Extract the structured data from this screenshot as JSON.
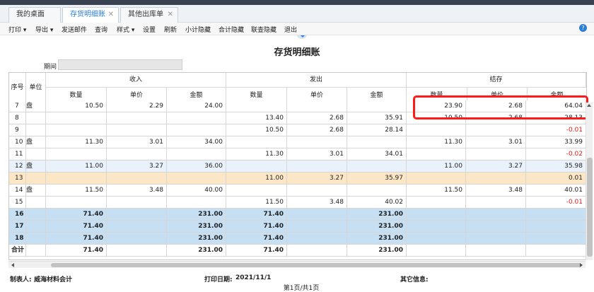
{
  "tabs": [
    {
      "label": "我的桌面",
      "active": false,
      "closable": false
    },
    {
      "label": "存货明细账",
      "active": true,
      "closable": true
    },
    {
      "label": "其他出库单",
      "active": false,
      "closable": true
    }
  ],
  "toolbar": {
    "items": [
      {
        "label": "打印",
        "dropdown": true
      },
      {
        "label": "导出",
        "dropdown": true
      },
      {
        "label": "发送邮件",
        "dropdown": false
      },
      {
        "label": "查询",
        "dropdown": false
      },
      {
        "label": "样式",
        "dropdown": true
      },
      {
        "label": "设置",
        "dropdown": false
      },
      {
        "label": "刷新",
        "dropdown": false
      },
      {
        "label": "小计隐藏",
        "dropdown": false
      },
      {
        "label": "合计隐藏",
        "dropdown": false
      },
      {
        "label": "联查隐藏",
        "dropdown": false
      },
      {
        "label": "退出",
        "dropdown": false
      }
    ],
    "help_icon": "?"
  },
  "report": {
    "title": "存货明细账",
    "period_label": "期间",
    "period_value": ""
  },
  "table": {
    "headers": {
      "seq": "序号",
      "unit": "单位",
      "in_group": "收入",
      "out_group": "发出",
      "bal_group": "结存",
      "qty": "数量",
      "price": "单价",
      "amount": "金额"
    },
    "rows": [
      {
        "seq": "7",
        "unit": "盘",
        "in_qty": "10.50",
        "in_price": "2.29",
        "in_amt": "24.00",
        "out_qty": "",
        "out_price": "",
        "out_amt": "",
        "bal_qty": "23.90",
        "bal_price": "2.68",
        "bal_amt": "64.04",
        "style": "normal"
      },
      {
        "seq": "8",
        "unit": "",
        "in_qty": "",
        "in_price": "",
        "in_amt": "",
        "out_qty": "13.40",
        "out_price": "2.68",
        "out_amt": "35.91",
        "bal_qty": "10.50",
        "bal_price": "2.68",
        "bal_amt": "28.13",
        "style": "normal"
      },
      {
        "seq": "9",
        "unit": "",
        "in_qty": "",
        "in_price": "",
        "in_amt": "",
        "out_qty": "10.50",
        "out_price": "2.68",
        "out_amt": "28.14",
        "bal_qty": "",
        "bal_price": "",
        "bal_amt": "-0.01",
        "style": "normal"
      },
      {
        "seq": "10",
        "unit": "盘",
        "in_qty": "11.30",
        "in_price": "3.01",
        "in_amt": "34.00",
        "out_qty": "",
        "out_price": "",
        "out_amt": "",
        "bal_qty": "11.30",
        "bal_price": "3.01",
        "bal_amt": "33.99",
        "style": "normal"
      },
      {
        "seq": "11",
        "unit": "",
        "in_qty": "",
        "in_price": "",
        "in_amt": "",
        "out_qty": "11.30",
        "out_price": "3.01",
        "out_amt": "34.01",
        "bal_qty": "",
        "bal_price": "",
        "bal_amt": "-0.02",
        "style": "normal"
      },
      {
        "seq": "12",
        "unit": "盘",
        "in_qty": "11.00",
        "in_price": "3.27",
        "in_amt": "36.00",
        "out_qty": "",
        "out_price": "",
        "out_amt": "",
        "bal_qty": "11.00",
        "bal_price": "3.27",
        "bal_amt": "35.98",
        "style": "hover"
      },
      {
        "seq": "13",
        "unit": "",
        "in_qty": "",
        "in_price": "",
        "in_amt": "",
        "out_qty": "11.00",
        "out_price": "3.27",
        "out_amt": "35.97",
        "bal_qty": "",
        "bal_price": "",
        "bal_amt": "0.01",
        "style": "selected"
      },
      {
        "seq": "14",
        "unit": "盘",
        "in_qty": "11.50",
        "in_price": "3.48",
        "in_amt": "40.00",
        "out_qty": "",
        "out_price": "",
        "out_amt": "",
        "bal_qty": "11.50",
        "bal_price": "3.48",
        "bal_amt": "40.01",
        "style": "normal"
      },
      {
        "seq": "15",
        "unit": "",
        "in_qty": "",
        "in_price": "",
        "in_amt": "",
        "out_qty": "11.50",
        "out_price": "3.48",
        "out_amt": "40.02",
        "bal_qty": "",
        "bal_price": "",
        "bal_amt": "-0.01",
        "style": "normal"
      },
      {
        "seq": "16",
        "unit": "",
        "in_qty": "71.40",
        "in_price": "",
        "in_amt": "231.00",
        "out_qty": "71.40",
        "out_price": "",
        "out_amt": "231.00",
        "bal_qty": "",
        "bal_price": "",
        "bal_amt": "",
        "style": "subtotal"
      },
      {
        "seq": "17",
        "unit": "",
        "in_qty": "71.40",
        "in_price": "",
        "in_amt": "231.00",
        "out_qty": "71.40",
        "out_price": "",
        "out_amt": "231.00",
        "bal_qty": "",
        "bal_price": "",
        "bal_amt": "",
        "style": "subtotal"
      },
      {
        "seq": "18",
        "unit": "",
        "in_qty": "71.40",
        "in_price": "",
        "in_amt": "231.00",
        "out_qty": "71.40",
        "out_price": "",
        "out_amt": "231.00",
        "bal_qty": "",
        "bal_price": "",
        "bal_amt": "",
        "style": "subtotal"
      },
      {
        "seq": "合计",
        "unit": "",
        "in_qty": "71.40",
        "in_price": "",
        "in_amt": "231.00",
        "out_qty": "71.40",
        "out_price": "",
        "out_amt": "231.00",
        "bal_qty": "",
        "bal_price": "",
        "bal_amt": "",
        "style": "total"
      }
    ]
  },
  "footer": {
    "maker_label": "制表人:",
    "maker_value": "威海材料会计",
    "print_date_label": "打印日期:",
    "print_date_value": "2021/11/1",
    "other_label": "其它信息:",
    "page_info": "第1页/共1页"
  },
  "colors": {
    "accent": "#2b7fd8",
    "hover_row": "#e9f1fb",
    "selected_row": "#fbe6c6",
    "subtotal_row": "#c6dff3",
    "negative": "#e02020",
    "highlight_box": "#ff1a1a"
  }
}
